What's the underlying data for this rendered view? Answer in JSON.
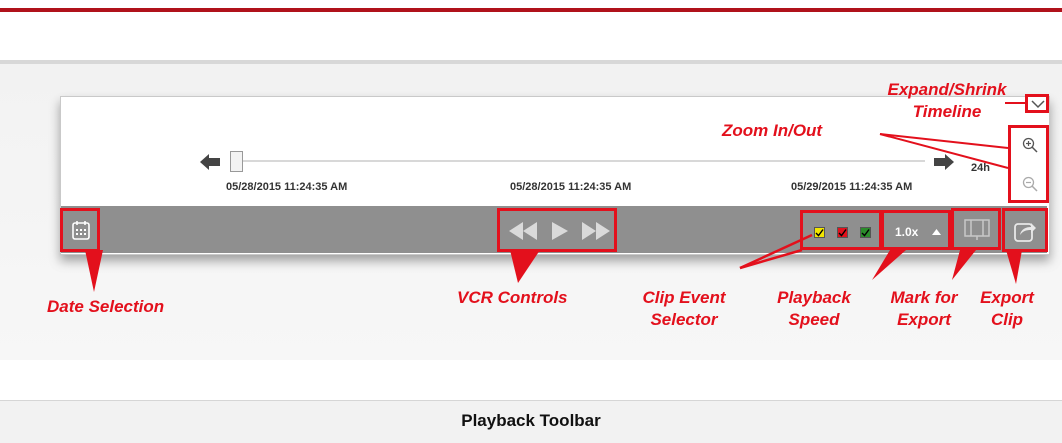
{
  "timeline": {
    "range_label": "24h",
    "timestamps": [
      "05/28/2015 11:24:35 AM",
      "05/28/2015 11:24:35 AM",
      "05/29/2015 11:24:35 AM"
    ]
  },
  "toolbar": {
    "playback_speed": "1.0x",
    "clip_event_colors": [
      "#f2e600",
      "#e3101c",
      "#2a8c2a"
    ]
  },
  "annotations": {
    "expand_shrink": [
      "Expand/Shrink",
      "Timeline"
    ],
    "zoom": "Zoom In/Out",
    "date_selection": "Date Selection",
    "vcr_controls": "VCR Controls",
    "clip_event_selector": [
      "Clip Event",
      "Selector"
    ],
    "playback_speed": [
      "Playback",
      "Speed"
    ],
    "mark_for_export": [
      "Mark for",
      "Export"
    ],
    "export_clip": [
      "Export",
      "Clip"
    ]
  },
  "caption": "Playback Toolbar",
  "colors": {
    "accent_red": "#e3101c",
    "header_red": "#b0121b",
    "toolbar_gray": "#8f8f8f"
  },
  "icons": [
    "calendar-icon",
    "rewind-icon",
    "play-icon",
    "fast-forward-icon",
    "zoom-in-icon",
    "zoom-out-icon",
    "chevron-down-icon",
    "mark-export-icon",
    "share-export-icon",
    "arrow-left-icon",
    "arrow-right-icon"
  ]
}
